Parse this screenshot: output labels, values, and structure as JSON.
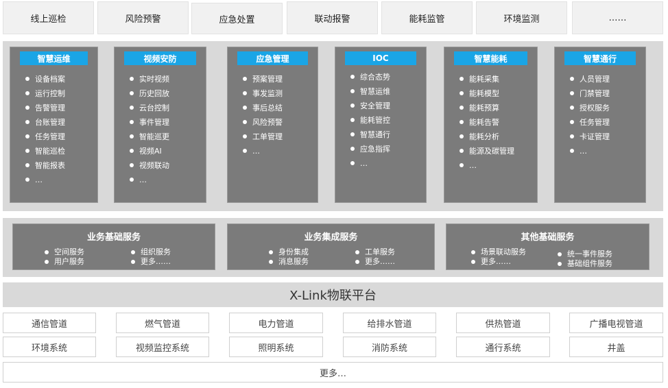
{
  "tabs": [
    "线上巡检",
    "风险预警",
    "应急处置",
    "联动报警",
    "能耗监管",
    "环境监测",
    "……"
  ],
  "modules": [
    {
      "title": "智慧运维",
      "items": [
        "设备档案",
        "运行控制",
        "告警管理",
        "台账管理",
        "任务管理",
        "智能巡检",
        "智能报表",
        "…"
      ]
    },
    {
      "title": "视频安防",
      "items": [
        "实时视频",
        "历史回放",
        "云台控制",
        "事件管理",
        "智能巡更",
        "视频AI",
        "视频联动",
        "…"
      ]
    },
    {
      "title": "应急管理",
      "items": [
        "预案管理",
        "事发监测",
        "事后总结",
        "风险预警",
        "工单管理",
        "…"
      ]
    },
    {
      "title": "IOC",
      "items": [
        "综合态势",
        "智慧运维",
        "安全管理",
        "能耗管控",
        "智慧通行",
        "应急指挥",
        "…"
      ]
    },
    {
      "title": "智慧能耗",
      "items": [
        "能耗采集",
        "能耗模型",
        "能耗预算",
        "能耗告警",
        "能耗分析",
        "能源及碳管理",
        "…"
      ]
    },
    {
      "title": "智慧通行",
      "items": [
        "人员管理",
        "门禁管理",
        "授权服务",
        "任务管理",
        "卡证管理",
        "…"
      ]
    }
  ],
  "services": [
    {
      "title": "业务基础服务",
      "col1": [
        "空间服务",
        "用户服务"
      ],
      "col2": [
        "组织服务",
        "更多……"
      ]
    },
    {
      "title": "业务集成服务",
      "col1": [
        "身份集成",
        "消息服务"
      ],
      "col2": [
        "工单服务",
        "更多……"
      ]
    },
    {
      "title": "其他基础服务",
      "col1": [
        "场景联动服务",
        "更多……"
      ],
      "col2": [
        "统一事件服务",
        "基础组件服务"
      ]
    }
  ],
  "platform": "X-Link物联平台",
  "infra_row1": [
    "通信管道",
    "燃气管道",
    "电力管道",
    "给排水管道",
    "供热管道",
    "广播电视管道"
  ],
  "infra_row2": [
    "环境系统",
    "视频监控系统",
    "照明系统",
    "消防系统",
    "通行系统",
    "井盖"
  ],
  "more": "更多…"
}
